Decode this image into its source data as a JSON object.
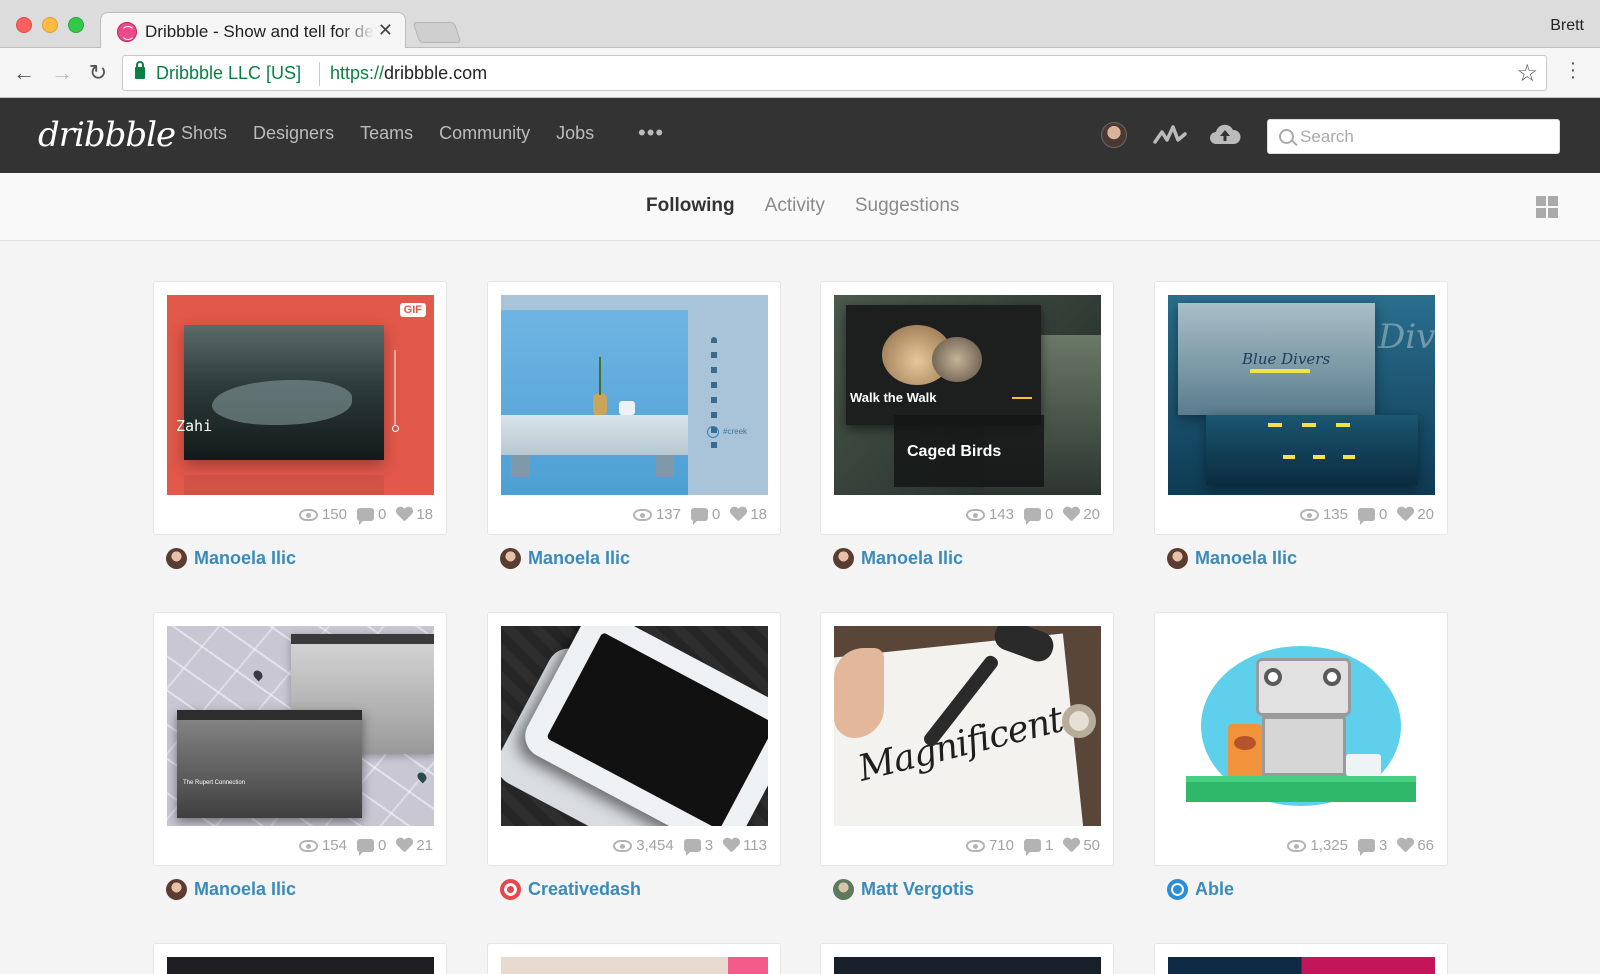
{
  "browser": {
    "tab_title": "Dribbble - Show and tell for designers",
    "profile_name": "Brett",
    "cert_label": "Dribbble LLC [US]",
    "url_protocol": "https://",
    "url_host": "dribbble.com"
  },
  "header": {
    "logo": "dribbble",
    "nav": [
      "Shots",
      "Designers",
      "Teams",
      "Community",
      "Jobs"
    ],
    "more": "•••",
    "search_placeholder": "Search"
  },
  "subnav": {
    "tabs": [
      "Following",
      "Activity",
      "Suggestions"
    ],
    "active_tab": "Following"
  },
  "shots": [
    {
      "art_text": "Zahi",
      "badge": "GIF",
      "views": "150",
      "comments": "0",
      "likes": "18",
      "author": "Manoela Ilic",
      "author_avatar": "#7b5a4a"
    },
    {
      "art_text": "#creek",
      "badge": "",
      "views": "137",
      "comments": "0",
      "likes": "18",
      "author": "Manoela Ilic",
      "author_avatar": "#7b5a4a"
    },
    {
      "art_text": "Walk the Walk",
      "art_text2": "Caged Birds",
      "badge": "",
      "views": "143",
      "comments": "0",
      "likes": "20",
      "author": "Manoela Ilic",
      "author_avatar": "#7b5a4a"
    },
    {
      "art_text": "Blue Divers",
      "art_text2": "Diver",
      "badge": "",
      "views": "135",
      "comments": "0",
      "likes": "20",
      "author": "Manoela Ilic",
      "author_avatar": "#7b5a4a"
    },
    {
      "art_text": "The Rupert Connection",
      "badge": "",
      "views": "154",
      "comments": "0",
      "likes": "21",
      "author": "Manoela Ilic",
      "author_avatar": "#7b5a4a"
    },
    {
      "art_text": "",
      "badge": "",
      "views": "3,454",
      "comments": "3",
      "likes": "113",
      "author": "Creativedash",
      "author_avatar": "#e8454d"
    },
    {
      "art_text": "Magnificent",
      "badge": "",
      "views": "710",
      "comments": "1",
      "likes": "50",
      "author": "Matt Vergotis",
      "author_avatar": "#6d8b6d"
    },
    {
      "art_text": "",
      "badge": "",
      "views": "1,325",
      "comments": "3",
      "likes": "66",
      "author": "Able",
      "author_avatar": "#2a8fd6"
    }
  ],
  "colors": {
    "header_bg": "#333333",
    "link_blue": "#3a8bbb",
    "dribbble_pink": "#ea4c89",
    "secure_green": "#0b8043"
  }
}
